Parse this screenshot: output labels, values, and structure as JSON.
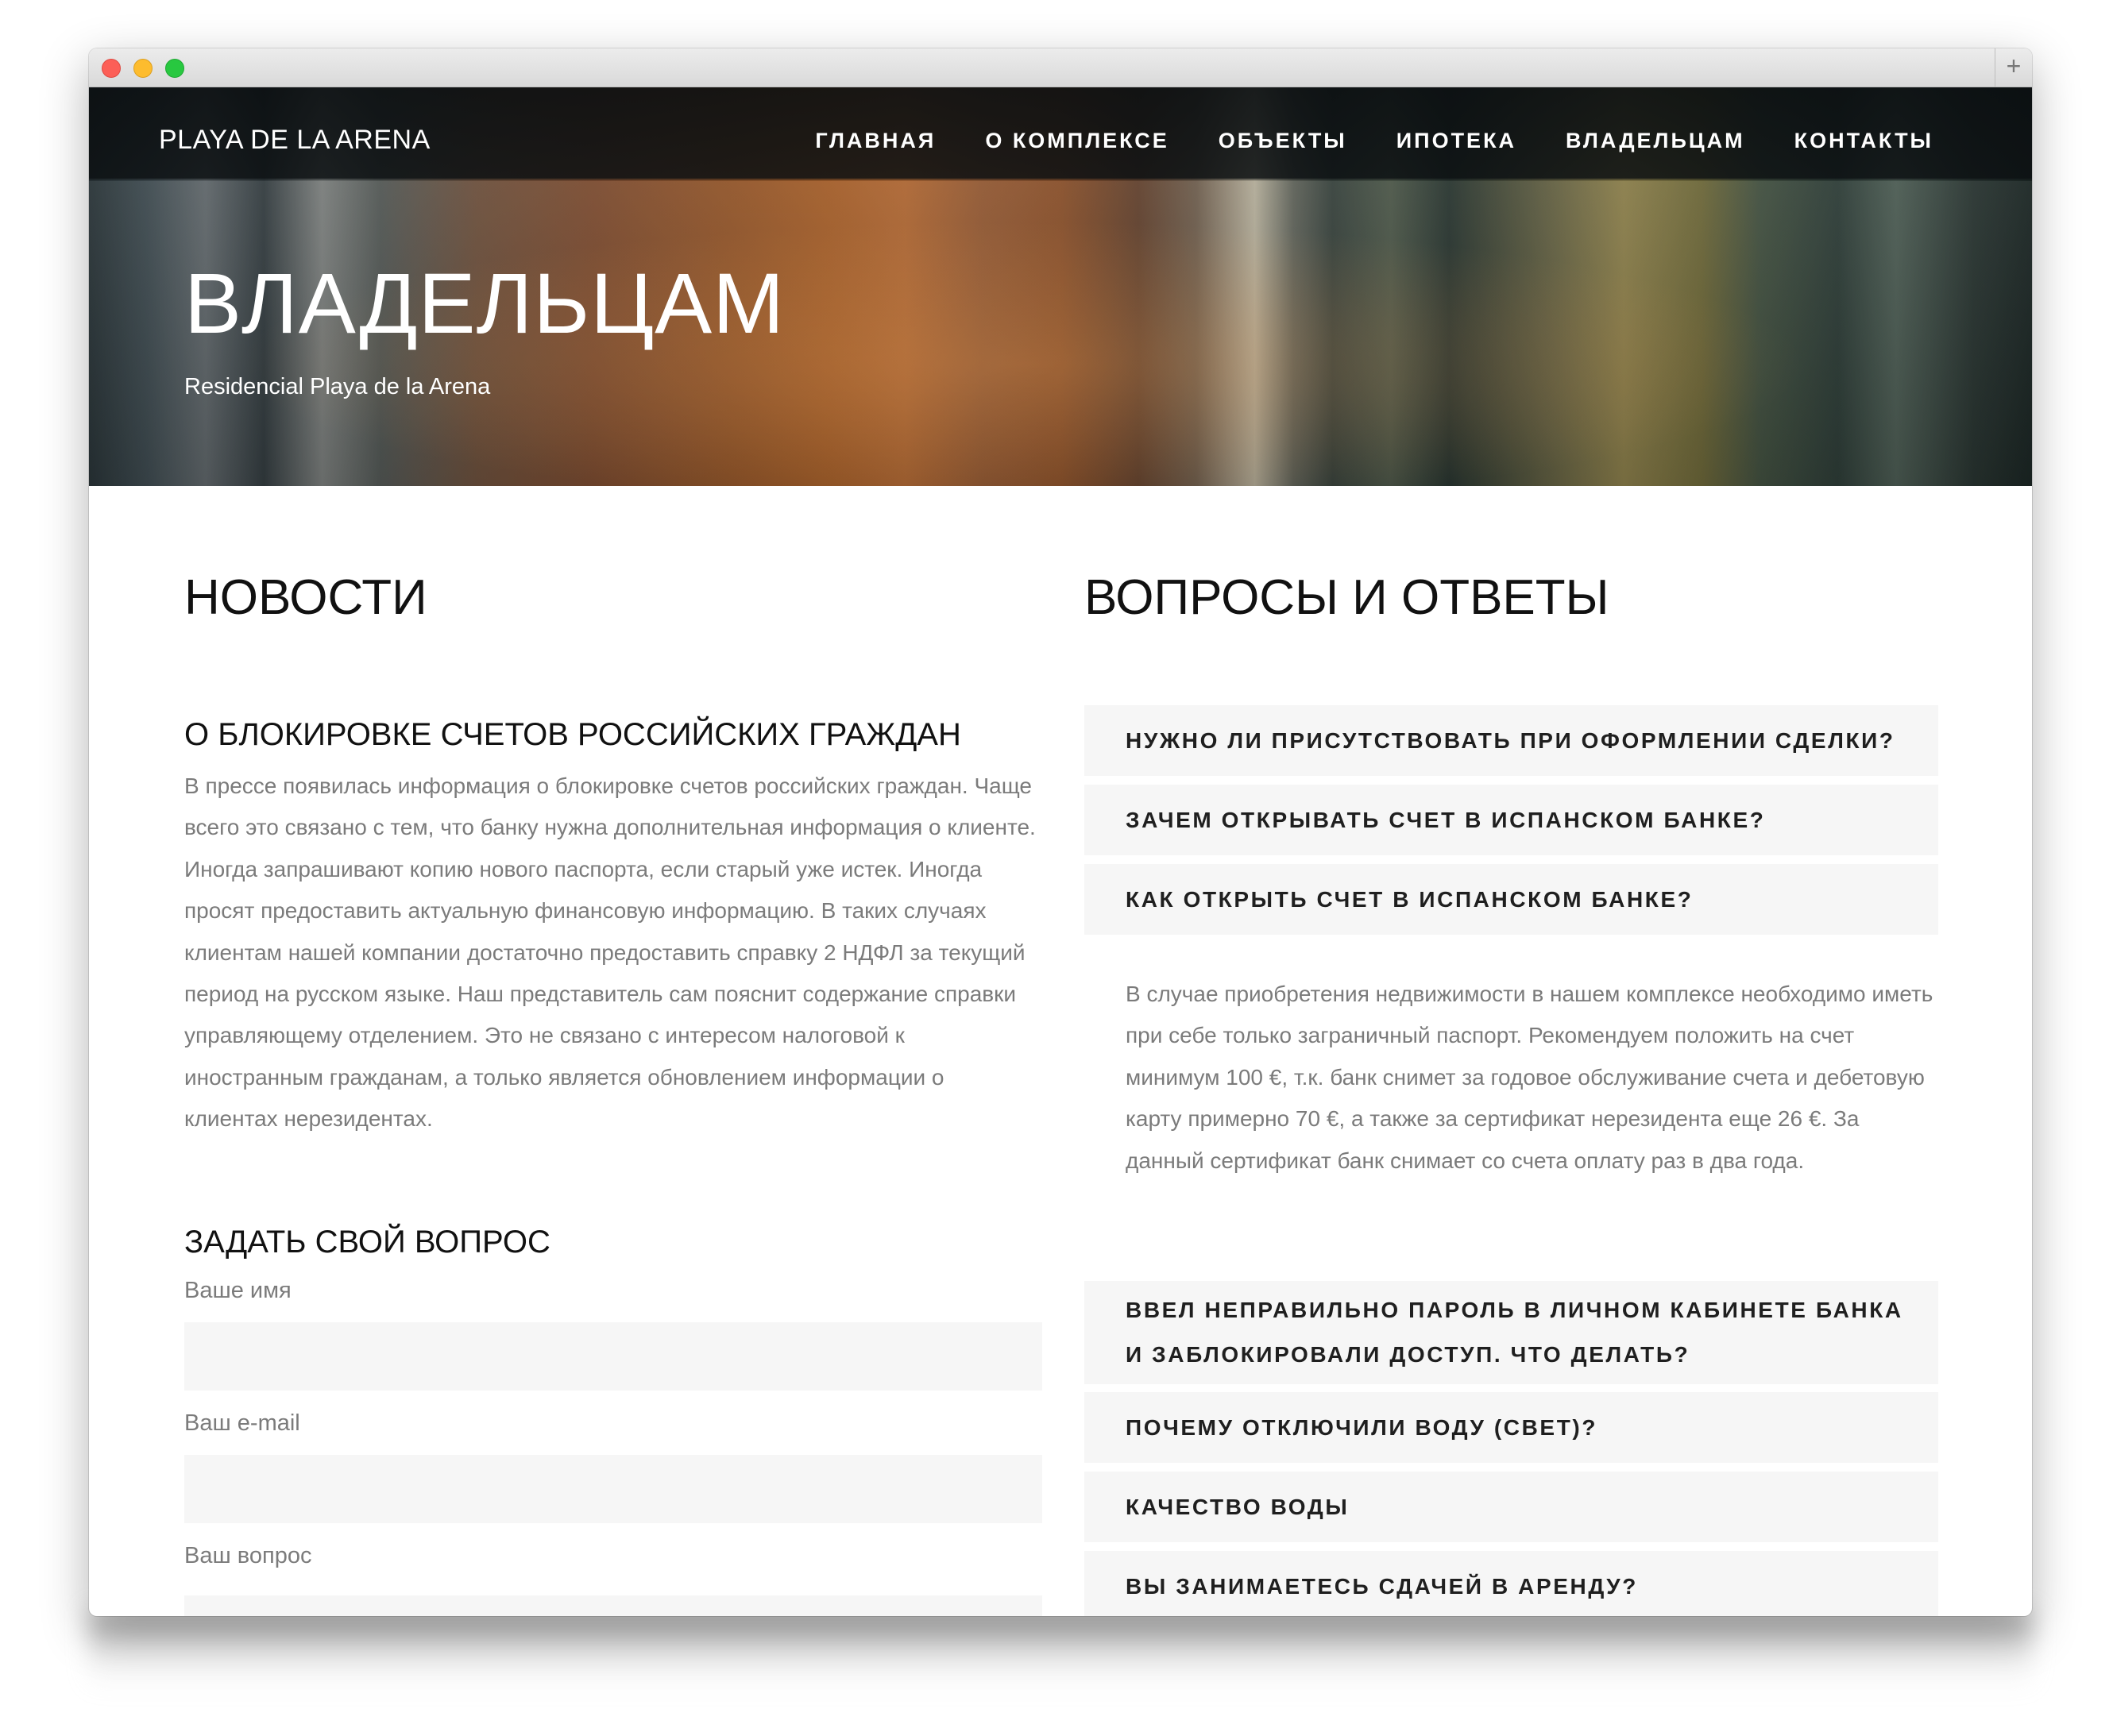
{
  "header": {
    "brand": "PLAYA DE LA ARENA",
    "nav": [
      "ГЛАВНАЯ",
      "О КОМПЛЕКСЕ",
      "ОБЪЕКТЫ",
      "ИПОТЕКА",
      "ВЛАДЕЛЬЦАМ",
      "КОНТАКТЫ"
    ]
  },
  "hero": {
    "title": "ВЛАДЕЛЬЦАМ",
    "subtitle": "Residencial Playa de la Arena"
  },
  "news": {
    "section_title": "НОВОСТИ",
    "article_title": "О БЛОКИРОВКЕ СЧЕТОВ РОССИЙСКИХ ГРАЖДАН",
    "article_text": "В прессе появилась информация о блокировке счетов российских граждан. Чаще всего это связано с тем, что банку нужна дополнительная информация о клиенте. Иногда запрашивают копию нового паспорта, если старый уже истек. Иногда просят предоставить актуальную финансовую информацию. В таких случаях клиентам нашей компании достаточно предоставить справку 2 НДФЛ за текущий период на русском языке. Наш представитель сам пояснит содержание справки управляющему отделением. Это не связано с интересом налоговой к иностранным гражданам, а только является обновлением информации о клиентах нерезидентах."
  },
  "form": {
    "title": "ЗАДАТЬ СВОЙ ВОПРОС",
    "name_label": "Ваше имя",
    "email_label": "Ваш e-mail",
    "question_label": "Ваш вопрос"
  },
  "faq": {
    "section_title": "ВОПРОСЫ И ОТВЕТЫ",
    "items": [
      "НУЖНО ЛИ ПРИСУТСТВОВАТЬ ПРИ ОФОРМЛЕНИИ СДЕЛКИ?",
      "ЗАЧЕМ ОТКРЫВАТЬ СЧЕТ В ИСПАНСКОМ БАНКЕ?",
      "КАК ОТКРЫТЬ СЧЕТ В ИСПАНСКОМ БАНКЕ?",
      "ВВЕЛ НЕПРАВИЛЬНО ПАРОЛЬ В ЛИЧНОМ КАБИНЕТЕ БАНКА И ЗАБЛОКИРОВАЛИ ДОСТУП. ЧТО ДЕЛАТЬ?",
      "ПОЧЕМУ ОТКЛЮЧИЛИ ВОДУ (СВЕТ)?",
      "КАЧЕСТВО ВОДЫ",
      "ВЫ ЗАНИМАЕТЕСЬ СДАЧЕЙ В АРЕНДУ?"
    ],
    "open_answer": "В случае приобретения недвижимости в нашем комплексе необходимо иметь при себе только заграничный паспорт. Рекомендуем положить на счет минимум 100 €, т.к. банк снимет за годовое обслуживание счета и дебетовую карту примерно 70 €, а также за сертификат нерезидента еще 26 €. За данный сертификат банк снимает со счета оплату раз в два года."
  }
}
